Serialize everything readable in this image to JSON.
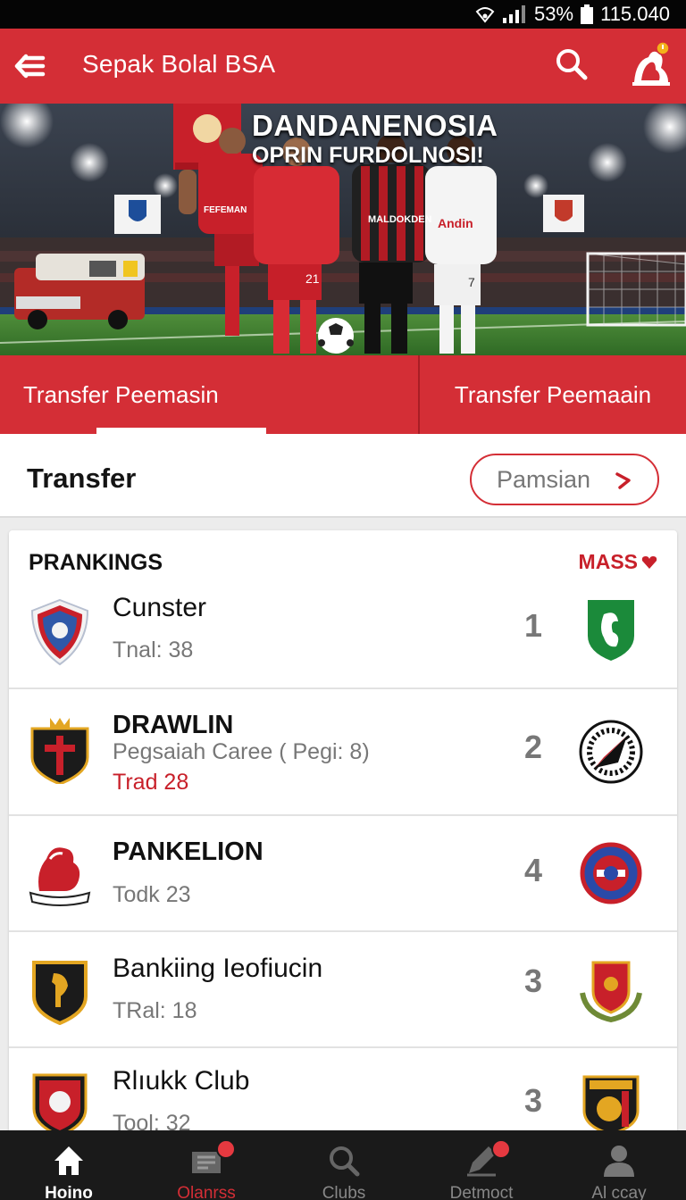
{
  "status_bar": {
    "battery": "53%",
    "time": "115.040"
  },
  "app_bar": {
    "title": "Sepak Bolal BSA"
  },
  "hero": {
    "title": "DANDANENOSIA",
    "subtitle": "OPRIN FURDOLNOSI!",
    "jersey_text_1": "FEFEMAN",
    "jersey_text_2": "MALDOKDEN",
    "jersey_text_3": "Andin",
    "jersey_number_1": "21",
    "jersey_number_2": "7"
  },
  "tabs": [
    {
      "label": "Transfer Peemasin",
      "active": true
    },
    {
      "label": "Transfer Peemaain",
      "active": false
    }
  ],
  "section": {
    "title": "Transfer",
    "button_label": "Pamsian"
  },
  "rankings": {
    "title": "PRANKINGS",
    "filter_label": "MASS",
    "rows": [
      {
        "name": "Cunster",
        "sub": "Tnal: 38",
        "rank": "1"
      },
      {
        "name": "DRAWLIN",
        "sub": "Pegsaiah Caree ( Pegi: 8)",
        "sub2": "Trad 28",
        "rank": "2"
      },
      {
        "name": "PANKELION",
        "sub": "Todk 23",
        "rank": "4"
      },
      {
        "name": "Bankiing Ieofiucin",
        "sub": "TRal: 18",
        "rank": "3"
      },
      {
        "name": "Rlıukk Club",
        "sub": "Tool: 32",
        "rank": "3"
      }
    ]
  },
  "bottom_nav": [
    {
      "label": "Hoino",
      "icon": "home-icon",
      "active": true
    },
    {
      "label": "Olanrss",
      "icon": "news-icon",
      "badge": true
    },
    {
      "label": "Clubs",
      "icon": "search-icon"
    },
    {
      "label": "Detmoct",
      "icon": "edit-icon",
      "badge": true
    },
    {
      "label": "Al ccay",
      "icon": "profile-icon"
    }
  ],
  "colors": {
    "primary": "#d42e36",
    "dark": "#1a1a1a",
    "muted": "#777777"
  }
}
